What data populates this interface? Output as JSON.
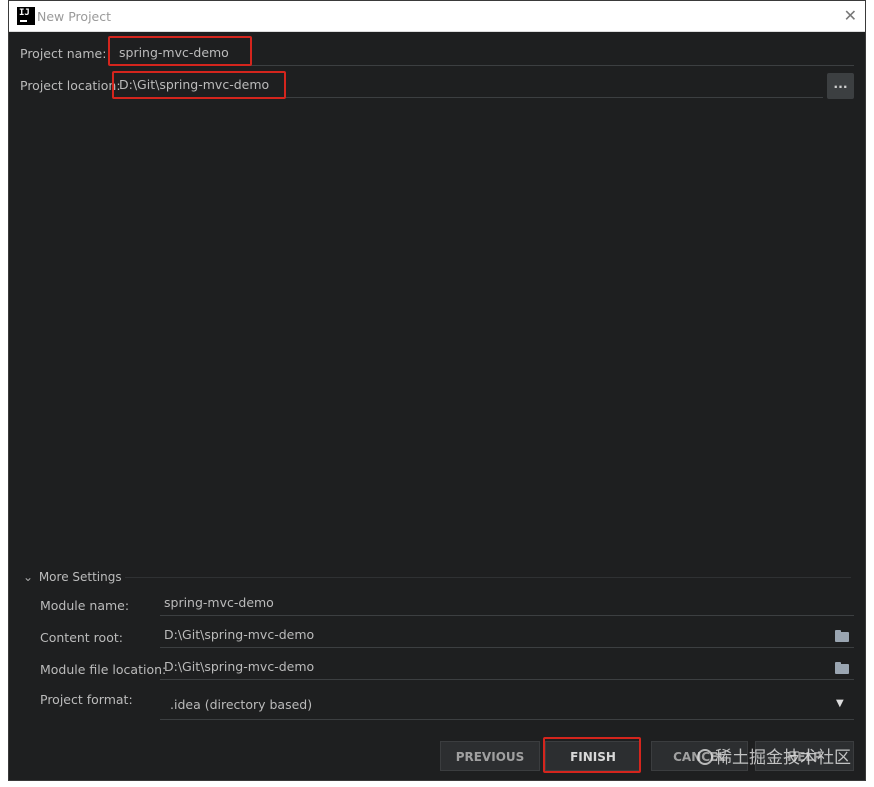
{
  "window": {
    "title": "New Project",
    "close_symbol": "✕",
    "app_icon_text": "IJ"
  },
  "project": {
    "name_label": "Project name:",
    "name_value": "spring-mvc-demo",
    "location_label": "Project location:",
    "location_value": "D:\\Git\\spring-mvc-demo",
    "browse_label": "..."
  },
  "more_settings": {
    "title": "More Settings",
    "expanded_symbol": "⌄",
    "module_name_label": "Module name:",
    "module_name_value": "spring-mvc-demo",
    "content_root_label": "Content root:",
    "content_root_value": "D:\\Git\\spring-mvc-demo",
    "module_file_label": "Module file location:",
    "module_file_value": "D:\\Git\\spring-mvc-demo",
    "project_format_label": "Project format:",
    "project_format_value": ".idea (directory based)",
    "select_symbol": "▼"
  },
  "buttons": {
    "previous": "PREVIOUS",
    "finish": "FINISH",
    "cancel": "CANCEL",
    "help": "HELP"
  },
  "watermark": {
    "text": "稀土掘金技术社区"
  },
  "colors": {
    "highlight": "#d4251d",
    "background": "#1e1f20"
  }
}
